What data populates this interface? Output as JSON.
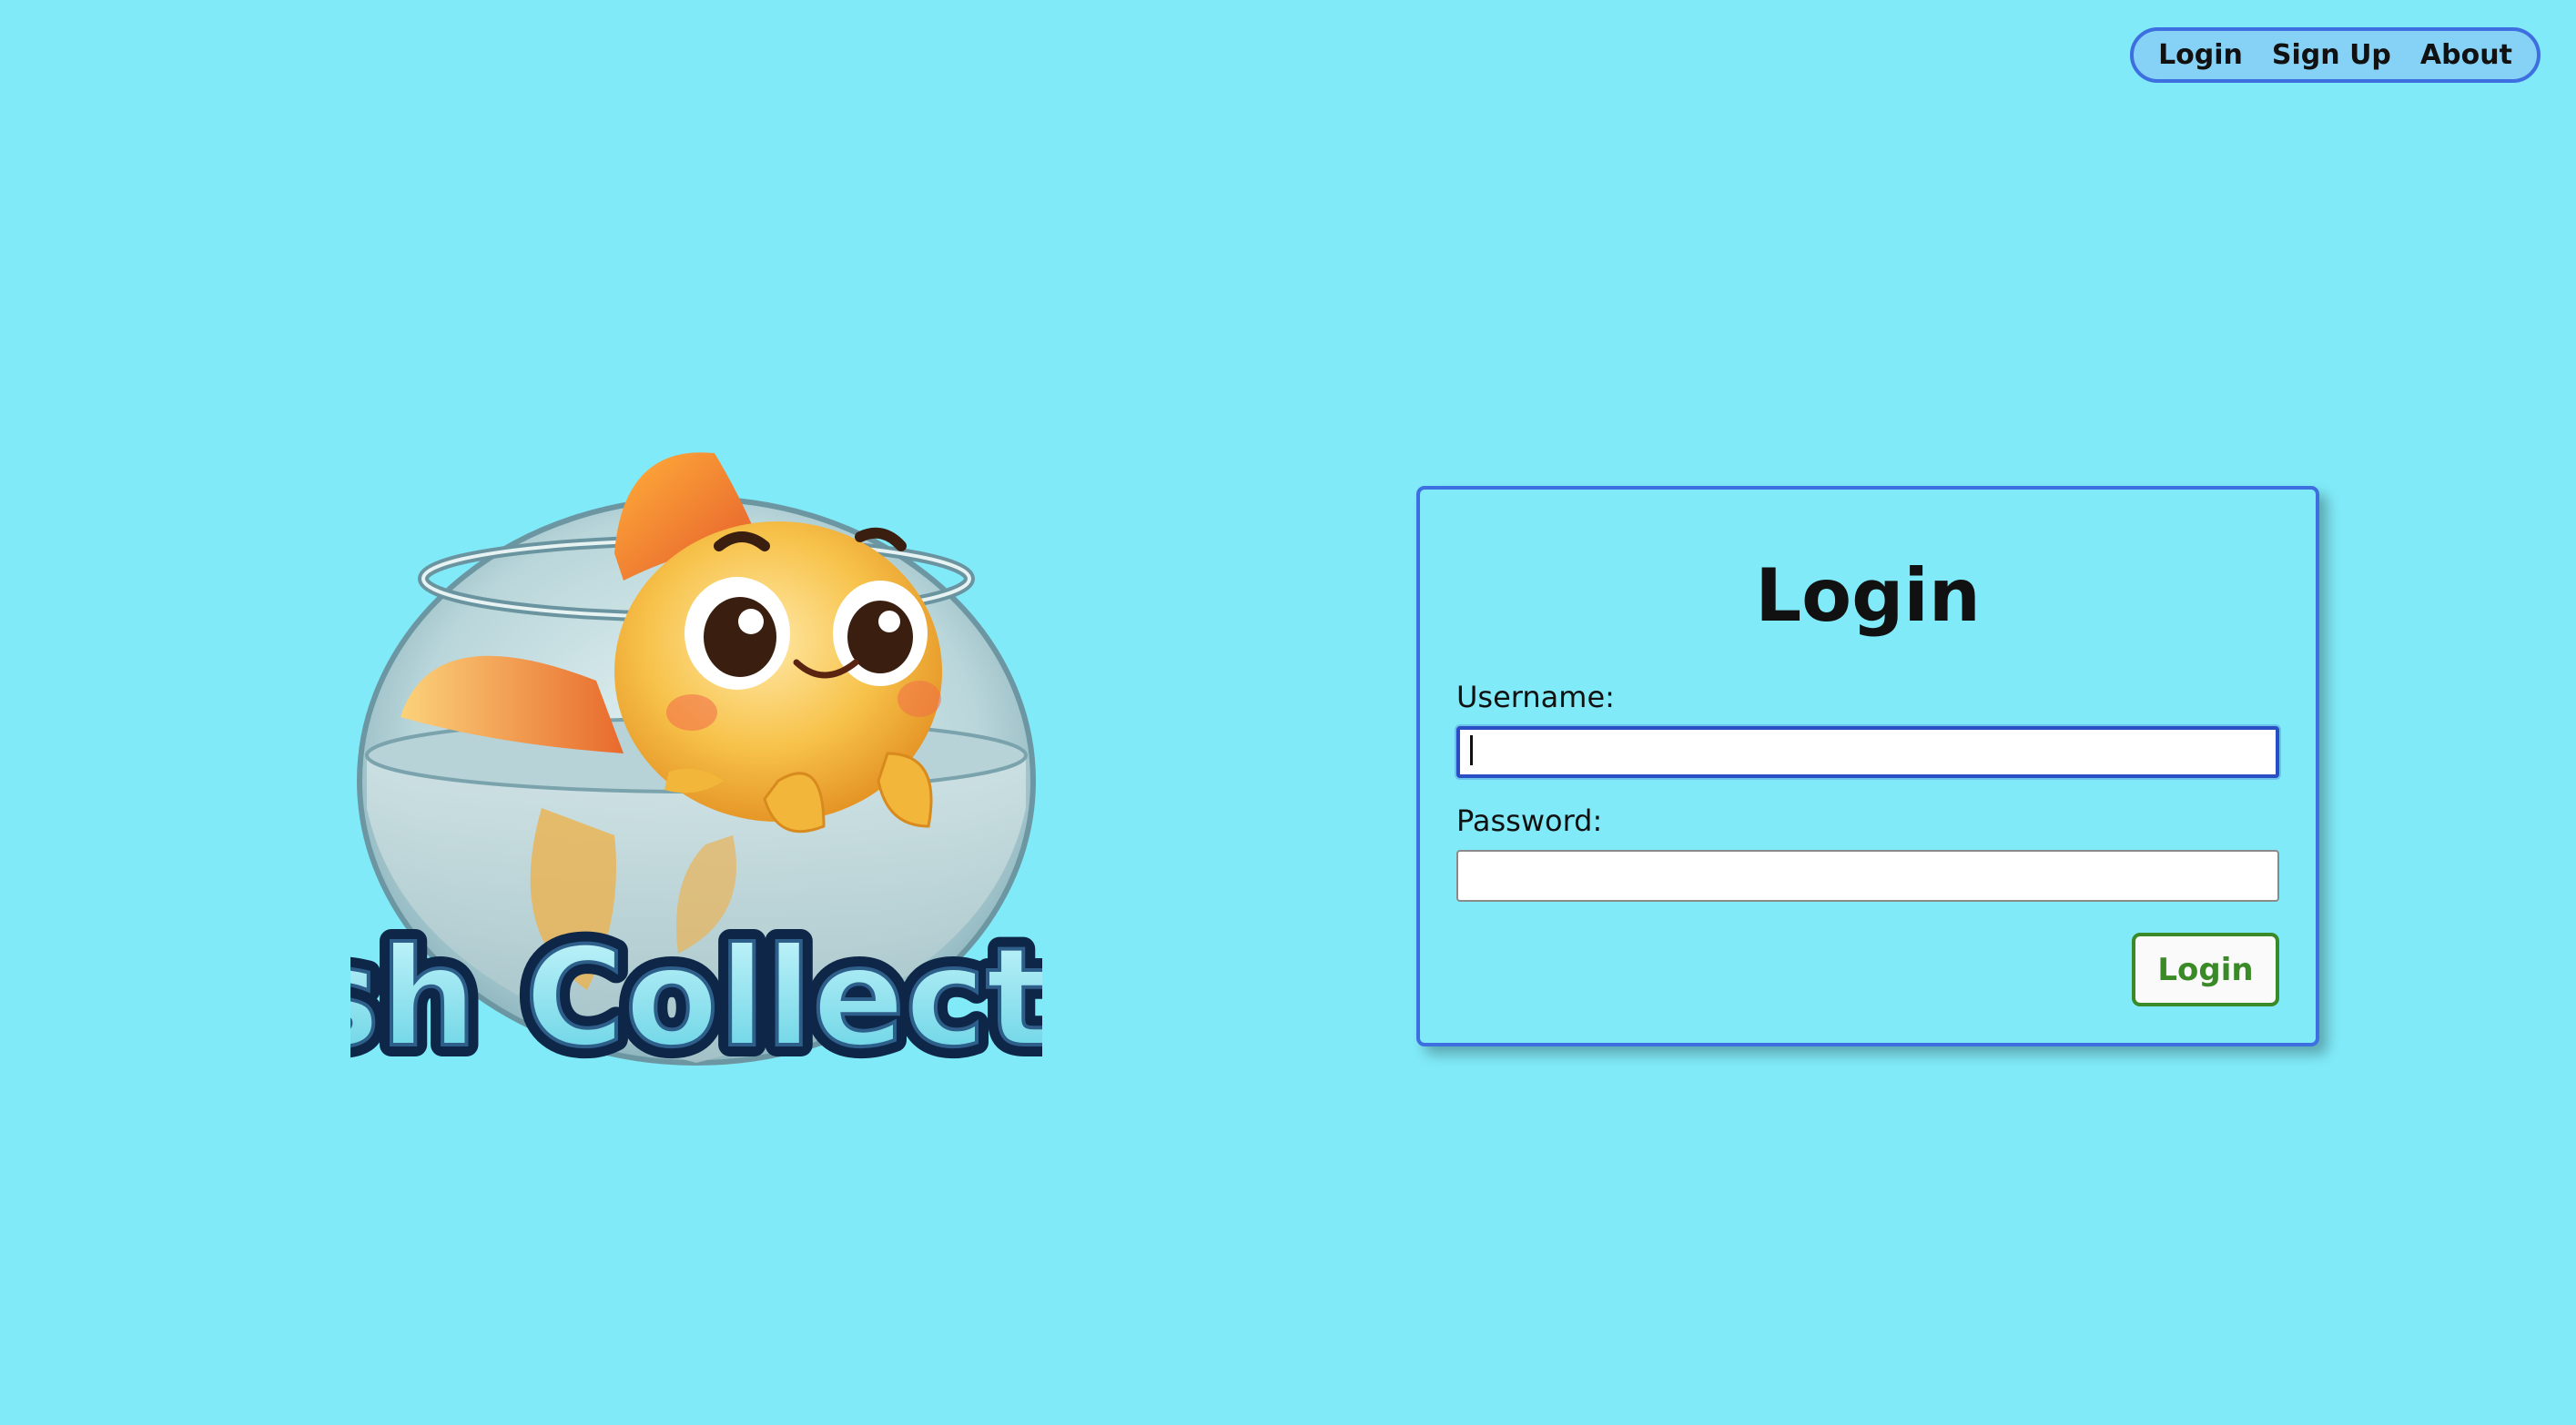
{
  "nav": {
    "items": [
      {
        "label": "Login"
      },
      {
        "label": "Sign Up"
      },
      {
        "label": "About"
      }
    ]
  },
  "logo": {
    "text": "Fish Collector",
    "icon": "goldfish-in-bowl"
  },
  "login_form": {
    "title": "Login",
    "username_label": "Username:",
    "username_value": "",
    "password_label": "Password:",
    "password_value": "",
    "submit_label": "Login"
  },
  "colors": {
    "background": "#80eaf8",
    "nav_background": "#86d2f6",
    "border_accent": "#3d6fe0",
    "submit_green": "#3a8a28"
  }
}
